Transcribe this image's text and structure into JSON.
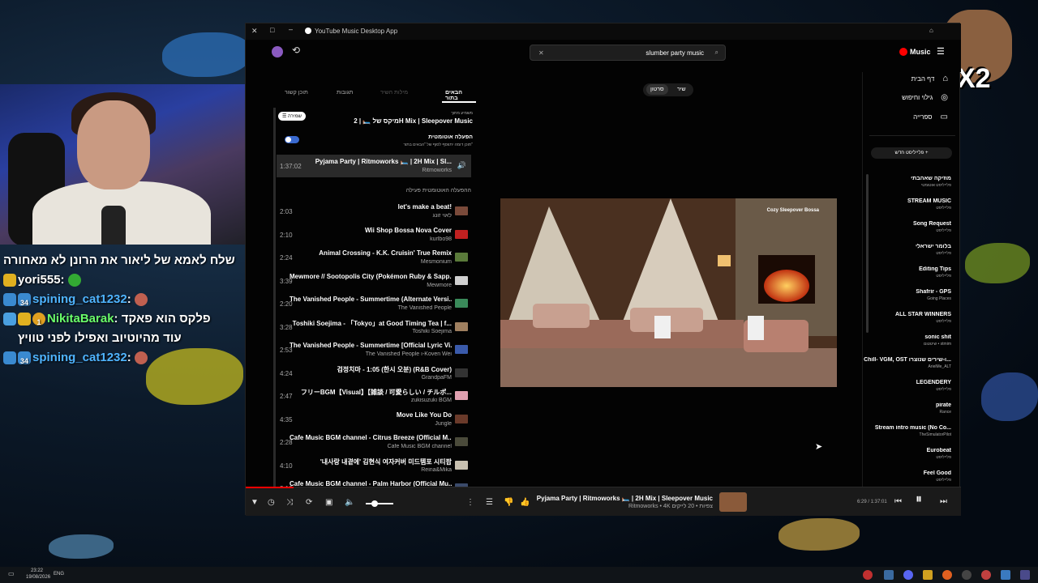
{
  "stream": {
    "overlay_label": "X2",
    "chat": [
      {
        "text": "שלח לאמא של ליאור את הרונן לא מאחורה"
      },
      {
        "user": "yori555",
        "msg": ""
      },
      {
        "user": "spining_cat1232",
        "msg": "",
        "badge_num": "34"
      },
      {
        "user": "NikitaBarak",
        "msg": "פלקס הוא פאקד",
        "badge_num": "1"
      },
      {
        "text": "עוד מהיוטיוב ואפילו לפני טוויץ"
      },
      {
        "user": "spining_cat1232",
        "msg": "",
        "badge_num": "34"
      }
    ]
  },
  "window": {
    "title": "YouTube Music Desktop App"
  },
  "search": {
    "value": "slumber party music"
  },
  "brand": {
    "label": "Music",
    "color": "#ff0000"
  },
  "toggle": {
    "song": "שיר",
    "video": "סרטון"
  },
  "tabs": [
    "תוכן קשור",
    "תגובות",
    "מילות השיר",
    "הבאים בתור"
  ],
  "queue_header": {
    "playing_from": "משמיע מתוך",
    "mix_title": "מיקס של 🛏️ | 2H Mix | Sleepover Music",
    "save_label": "שמירה",
    "autoplay_title": "הפעלה אוטומטית",
    "autoplay_desc": "תוכן דומה יתווסף לסוף של \"הבאים בתור\""
  },
  "now_in_queue": {
    "duration": "1:37:02",
    "title": "Pyjama Party | Ritmoworks 🛏️ | 2H Mix | Sl...",
    "artist": "Ritmoworks"
  },
  "autoplay_section": "ההפעלה האוטומטית פעילה",
  "queue": [
    {
      "duration": "2:03",
      "title": "let's make a beat!",
      "artist": "לאוי זונג",
      "color": "#7a4a3a"
    },
    {
      "duration": "2:10",
      "title": "Wii Shop Bossa Nova Cover",
      "artist": "kurlbo98",
      "color": "#c02020"
    },
    {
      "duration": "2:24",
      "title": "Animal Crossing - K.K. Cruisin' True Remix",
      "artist": "Mesmonium",
      "color": "#5a7a3a"
    },
    {
      "duration": "3:39",
      "title": "Mewmore // Sootopolis City (Pokémon Ruby & Sapp...",
      "artist": "Mewmore",
      "color": "#d0d0d0"
    },
    {
      "duration": "2:20",
      "title": "The Vanished People - Summertime (Alternate Versi...",
      "artist": "The Vanished People",
      "color": "#3a8a5a"
    },
    {
      "duration": "3:28",
      "title": "Toshiki Soejima - 「Tokyo」at Good Timing Tea | f...",
      "artist": "Toshiki Soejima",
      "color": "#a08060"
    },
    {
      "duration": "2:53",
      "title": "The Vanished People - Summertime [Official Lyric Vi...",
      "artist": "The Vanished People ו-Koven Wei",
      "color": "#3a5aaa"
    },
    {
      "duration": "4:24",
      "title": "검정치마 - 1:05 (한시 오분) (R&B Cover)",
      "artist": "GrandpaFM",
      "color": "#333333"
    },
    {
      "duration": "2:47",
      "title": "フリーBGM【Visual】【雑談 / 可愛らしい / チルポ...",
      "artist": "zukisuzuki BGM",
      "color": "#e0a0b0"
    },
    {
      "duration": "4:35",
      "title": "Move Like You Do",
      "artist": "Jungle",
      "color": "#6a3a2a"
    },
    {
      "duration": "2:28",
      "title": "Cafe Music BGM channel - Citrus Breeze (Official M...",
      "artist": "Cafe Music BGM channel",
      "color": "#4a4a3a"
    },
    {
      "duration": "4:10",
      "title": "'내사랑 내곁에' 김현식 여자커버 미드템포 시티팝",
      "artist": "Reina&Mika",
      "color": "#c8c0b0"
    },
    {
      "duration": "3:10",
      "title": "Cafe Music BGM channel - Palm Harbor (Official Mu...",
      "artist": "",
      "color": "#3a4a6a"
    }
  ],
  "artwork": {
    "caption": "Cozy Sleepover Bossa"
  },
  "nav": [
    {
      "label": "דף הבית",
      "icon": "home-icon"
    },
    {
      "label": "גילוי וחיפוש",
      "icon": "explore-icon"
    },
    {
      "label": "ספרייה",
      "icon": "library-icon"
    }
  ],
  "new_playlist": "פלייליסט חדש",
  "playlists": [
    {
      "title": "מוזיקה שאהבתי",
      "sub": "פלייליסט אוטומטי"
    },
    {
      "title": "STREAM MUSIC",
      "sub": "פלייליסט"
    },
    {
      "title": "Song Request",
      "sub": "פלייליסט"
    },
    {
      "title": "בלומר ישראלי",
      "sub": "פלייליסט"
    },
    {
      "title": "Editing Tips",
      "sub": "פלייליסט"
    },
    {
      "title": "Shafrir - GPS",
      "sub": "Going Places"
    },
    {
      "title": "ALL STAR WINNERS",
      "sub": "פלייליסט"
    },
    {
      "title": "sonic shit",
      "sub": "שיטטום • stmim"
    },
    {
      "title": "Chill- VGM, OST ו-שירים שנוצרו...",
      "sub": "ArielMe_ALT"
    },
    {
      "title": "LEGENDERY",
      "sub": "פלייליסט"
    },
    {
      "title": "pirate",
      "sub": "Rance"
    },
    {
      "title": "Stream intro music (No Co...",
      "sub": "TheSimulatorPilot"
    },
    {
      "title": "Eurobeat",
      "sub": "פלייליסט"
    },
    {
      "title": "Feel Good",
      "sub": "פלייליסט"
    }
  ],
  "player": {
    "title": "Pyjama Party | Ritmoworks 🛏️ | 2H Mix | Sleepover Music",
    "subtitle": "Ritmoworks • 4K צפיות • 20 לייקים",
    "time": "6:29 / 1:37:01",
    "progress_fraction": 0.067,
    "volume_fraction": 0.35
  },
  "taskbar": {
    "time": "23:22",
    "date": "19/08/2026",
    "lang": "ENG"
  }
}
